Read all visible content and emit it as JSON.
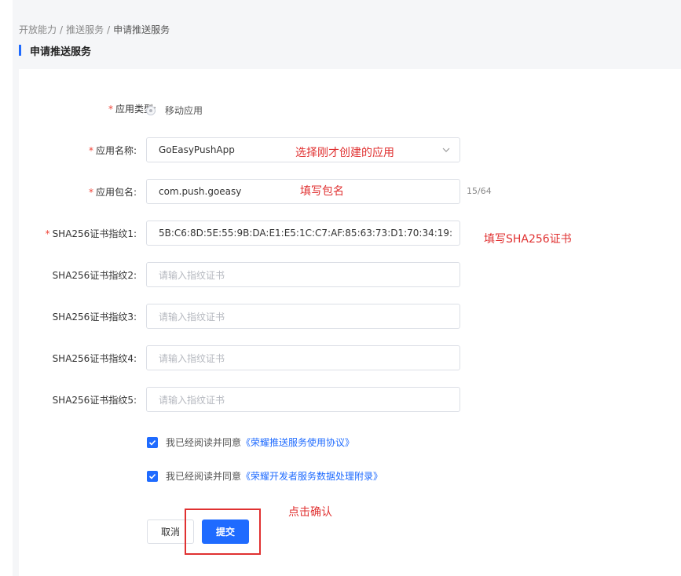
{
  "breadcrumb": {
    "items": [
      "开放能力",
      "推送服务",
      "申请推送服务"
    ],
    "separator": "/"
  },
  "page_title": "申请推送服务",
  "form": {
    "app_type": {
      "label": "应用类型:",
      "value": "移动应用"
    },
    "app_name": {
      "label": "应用名称:",
      "value": "GoEasyPushApp",
      "annotation": "选择刚才创建的应用"
    },
    "package_name": {
      "label": "应用包名:",
      "value": "com.push.goeasy",
      "counter": "15/64",
      "annotation": "填写包名"
    },
    "sha1": {
      "label": "SHA256证书指纹1:",
      "value": "5B:C6:8D:5E:55:9B:DA:E1:E5:1C:C7:AF:85:63:73:D1:70:34:19:",
      "annotation": "填写SHA256证书"
    },
    "sha2": {
      "label": "SHA256证书指纹2:",
      "placeholder": "请输入指纹证书"
    },
    "sha3": {
      "label": "SHA256证书指纹3:",
      "placeholder": "请输入指纹证书"
    },
    "sha4": {
      "label": "SHA256证书指纹4:",
      "placeholder": "请输入指纹证书"
    },
    "sha5": {
      "label": "SHA256证书指纹5:",
      "placeholder": "请输入指纹证书"
    },
    "required_mark": "*"
  },
  "agreements": [
    {
      "text": "我已经阅读并同意",
      "link": "《荣耀推送服务使用协议》",
      "checked": true
    },
    {
      "text": "我已经阅读并同意",
      "link": "《荣耀开发者服务数据处理附录》",
      "checked": true
    }
  ],
  "actions": {
    "cancel_label": "取消",
    "submit_label": "提交",
    "annotation": "点击确认"
  },
  "colors": {
    "accent": "#1f6bff",
    "annotation": "#e03131",
    "required": "#f04438"
  },
  "icons": {
    "dropdown": "chevron-down-icon",
    "checkbox": "check-icon"
  }
}
